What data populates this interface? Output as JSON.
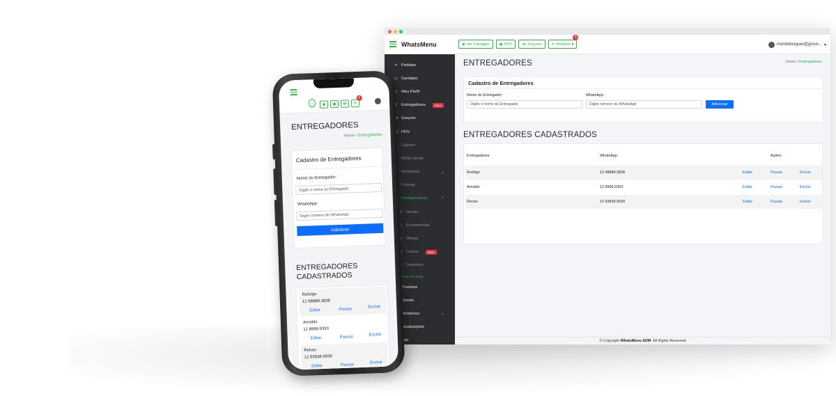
{
  "colors": {
    "accent": "#2fb34a",
    "primary": "#0d6efd",
    "sidebar": "#2b2d31",
    "danger": "#dc3545"
  },
  "desktop": {
    "brand": "WhatsMenu",
    "top_buttons": [
      {
        "label": "Ver Cardápio",
        "icon": "eye-icon"
      },
      {
        "label": "PDV",
        "icon": "store-icon"
      },
      {
        "label": "Garçom",
        "icon": "waiter-icon"
      },
      {
        "label": "Pedidos",
        "icon": "rocket-icon",
        "badge": "5"
      }
    ],
    "user": "mundoburguer@grove...",
    "sidebar": {
      "items": [
        {
          "label": "Pedidos",
          "icon": "rocket-icon"
        },
        {
          "label": "Cardápio",
          "icon": "menu-card-icon"
        },
        {
          "label": "Meu Perfil",
          "icon": "user-icon"
        },
        {
          "label": "Entregadores",
          "icon": "motorcycle-icon",
          "badge": "Novo"
        },
        {
          "label": "Garçom",
          "icon": "waiter-icon"
        },
        {
          "label": "PDV",
          "icon": "store-icon"
        },
        {
          "label": "Cupons",
          "icon": "ticket-icon"
        },
        {
          "label": "Mídia Social",
          "icon": "share-icon"
        },
        {
          "label": "Relatórios",
          "icon": "chart-icon"
        },
        {
          "label": "Faturas",
          "icon": "invoice-icon"
        },
        {
          "label": "Configurações",
          "icon": "gear-icon"
        },
        {
          "label": "Gerais",
          "icon": "gear-icon"
        },
        {
          "label": "Encomendas",
          "icon": "box-icon"
        },
        {
          "label": "Mesas",
          "icon": "table-icon"
        },
        {
          "label": "Caixas",
          "icon": "cash-icon",
          "badge": "Novo"
        },
        {
          "label": "Domínios",
          "icon": "globe-icon"
        }
      ],
      "section_label": "ADMINISTRADOR",
      "admin_items": [
        {
          "label": "Produtos",
          "icon": "box-icon"
        },
        {
          "label": "Cliente",
          "icon": "user-icon"
        },
        {
          "label": "Relatórios",
          "icon": "chart-icon"
        },
        {
          "label": "Atualizações",
          "icon": "refresh-icon"
        },
        {
          "label": "Sair",
          "icon": "logout-icon"
        }
      ]
    },
    "page_title": "ENTREGADORES",
    "breadcrumb": {
      "home": "Home",
      "sep": "/",
      "current": "Entregadores"
    },
    "form": {
      "title": "Cadastro de Entregadores",
      "name_label": "Nome do Entregador:",
      "name_placeholder": "Digite o nome do Entregador",
      "phone_label": "WhatsApp:",
      "phone_placeholder": "Digite número do WhatsApp",
      "submit": "Adicionar"
    },
    "list_title": "ENTREGADORES CADASTRADOS",
    "table": {
      "headers": [
        "Entregadores:",
        "WhatsApp:",
        "Ações:"
      ],
      "rows": [
        {
          "name": "Rodrigo",
          "phone": "12 98888.3838"
        },
        {
          "name": "Arnaldo",
          "phone": "12 8999.9393"
        },
        {
          "name": "Renan",
          "phone": "12 83838.9939"
        }
      ],
      "actions": [
        "Editar",
        "Pausar",
        "Excluir"
      ]
    },
    "footer": {
      "prefix": "© Copyright",
      "brand": "WhatsMenu ADM",
      "suffix": ". All Rights Reserved"
    }
  },
  "mobile": {
    "badge": "5",
    "page_title": "ENTREGADORES",
    "breadcrumb": {
      "home": "Home",
      "sep": "/",
      "current": "Entregadores"
    },
    "form": {
      "title": "Cadastro de Entregadores",
      "name_label": "Nome do Entregador:",
      "name_placeholder": "Digite o nome do Entregador",
      "phone_label": "WhatsApp:",
      "phone_placeholder": "Digite número do WhatsApp",
      "submit": "Adicionar"
    },
    "list_title_1": "ENTREGADORES",
    "list_title_2": "CADASTRADOS",
    "rows": [
      {
        "name": "Rodrigo",
        "phone": "12 98888.3838"
      },
      {
        "name": "Arnaldo",
        "phone": "12 8999.9393"
      },
      {
        "name": "Renan",
        "phone": "12 83838.9939"
      }
    ],
    "actions": [
      "Editar",
      "Pausar",
      "Excluir"
    ]
  }
}
